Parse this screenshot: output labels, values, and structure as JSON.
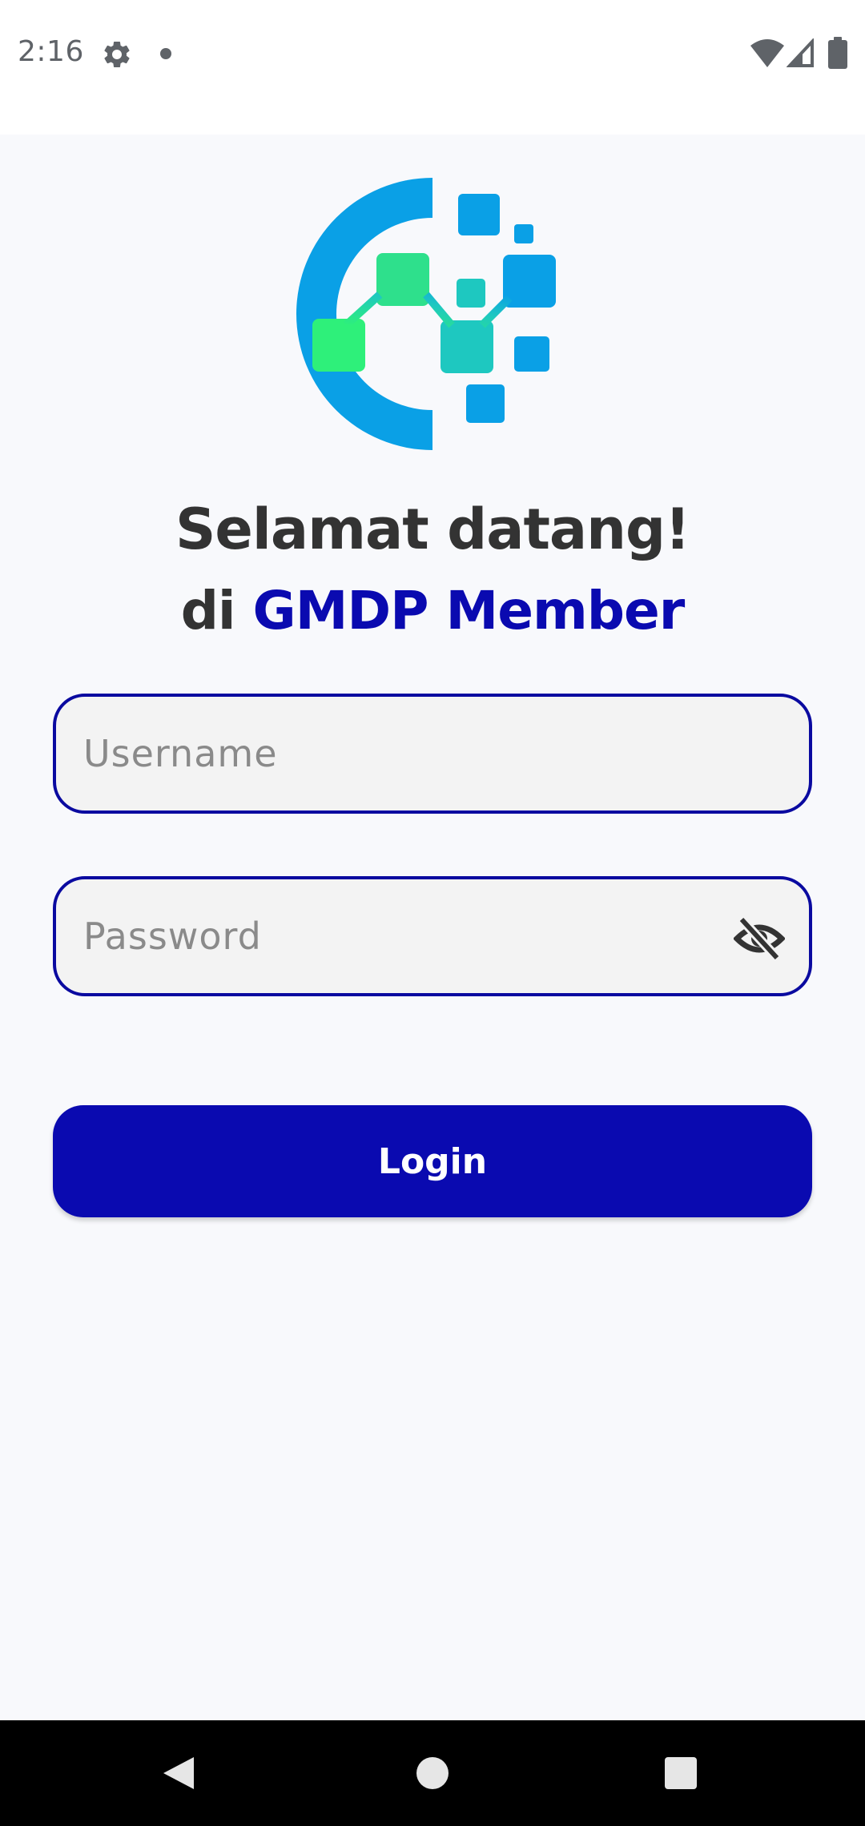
{
  "status_bar": {
    "time": "2:16",
    "icons": [
      "settings-gear-icon",
      "notification-dot-icon",
      "wifi-icon",
      "cell-signal-icon",
      "battery-icon"
    ]
  },
  "header": {
    "logo_icon": "gmdp-logo-icon",
    "welcome": "Selamat datang!",
    "brand_prefix": "di ",
    "brand_name": "GMDP Member"
  },
  "form": {
    "username": {
      "value": "",
      "placeholder": "Username"
    },
    "password": {
      "value": "",
      "placeholder": "Password",
      "toggle_icon": "eye-off-icon"
    },
    "login_label": "Login"
  },
  "nav_bar": {
    "icons": [
      "back-icon",
      "home-icon",
      "recents-icon"
    ]
  },
  "colors": {
    "brand": "#0a0ab0",
    "field_border": "#0a0aa0",
    "field_fill": "#f3f3f3",
    "background": "#f8f9fc",
    "heading": "#333333",
    "logo_blue": "#0aa0e6",
    "logo_green": "#2ef07a",
    "logo_teal": "#1ec8c0"
  }
}
